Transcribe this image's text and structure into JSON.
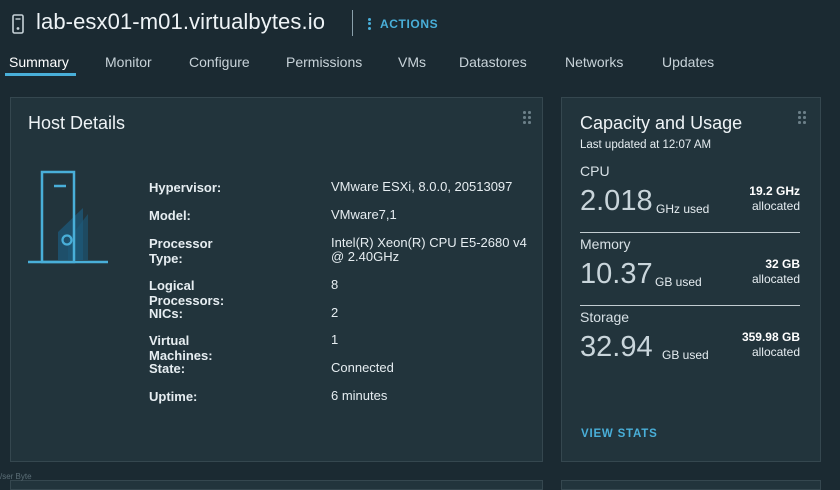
{
  "header": {
    "title": "lab-esx01-m01.virtualbytes.io",
    "actions_label": "ACTIONS",
    "host_icon": "host-icon"
  },
  "tabs": [
    {
      "label": "Summary",
      "active": true
    },
    {
      "label": "Monitor"
    },
    {
      "label": "Configure"
    },
    {
      "label": "Permissions"
    },
    {
      "label": "VMs"
    },
    {
      "label": "Datastores"
    },
    {
      "label": "Networks"
    },
    {
      "label": "Updates"
    }
  ],
  "host_details": {
    "title": "Host Details",
    "rows": [
      {
        "label": "Hypervisor:",
        "value": "VMware ESXi, 8.0.0, 20513097"
      },
      {
        "label": "Model:",
        "value": "VMware7,1"
      },
      {
        "label": "Processor Type:",
        "value": "Intel(R) Xeon(R) CPU E5-2680 v4 @ 2.40GHz"
      },
      {
        "label": "Logical Processors:",
        "value": "8"
      },
      {
        "label": "NICs:",
        "value": "2"
      },
      {
        "label": "Virtual Machines:",
        "value": "1"
      },
      {
        "label": "State:",
        "value": "Connected"
      },
      {
        "label": "Uptime:",
        "value": "6 minutes"
      }
    ]
  },
  "capacity": {
    "title": "Capacity and Usage",
    "last_updated": "Last updated at 12:07 AM",
    "cpu": {
      "label": "CPU",
      "used": "2.018",
      "unit": "GHz used",
      "allocated": "19.2 GHz",
      "allocated_label": "allocated"
    },
    "memory": {
      "label": "Memory",
      "used": "10.37",
      "unit": "GB used",
      "allocated": "32 GB",
      "allocated_label": "allocated"
    },
    "storage": {
      "label": "Storage",
      "used": "32.94",
      "unit": "GB used",
      "allocated": "359.98 GB",
      "allocated_label": "allocated"
    },
    "view_stats": "VIEW STATS"
  },
  "colors": {
    "background": "#1b2a32",
    "card": "#22343c",
    "accent": "#49afd9"
  },
  "footer_fragment": "/ser Byte"
}
